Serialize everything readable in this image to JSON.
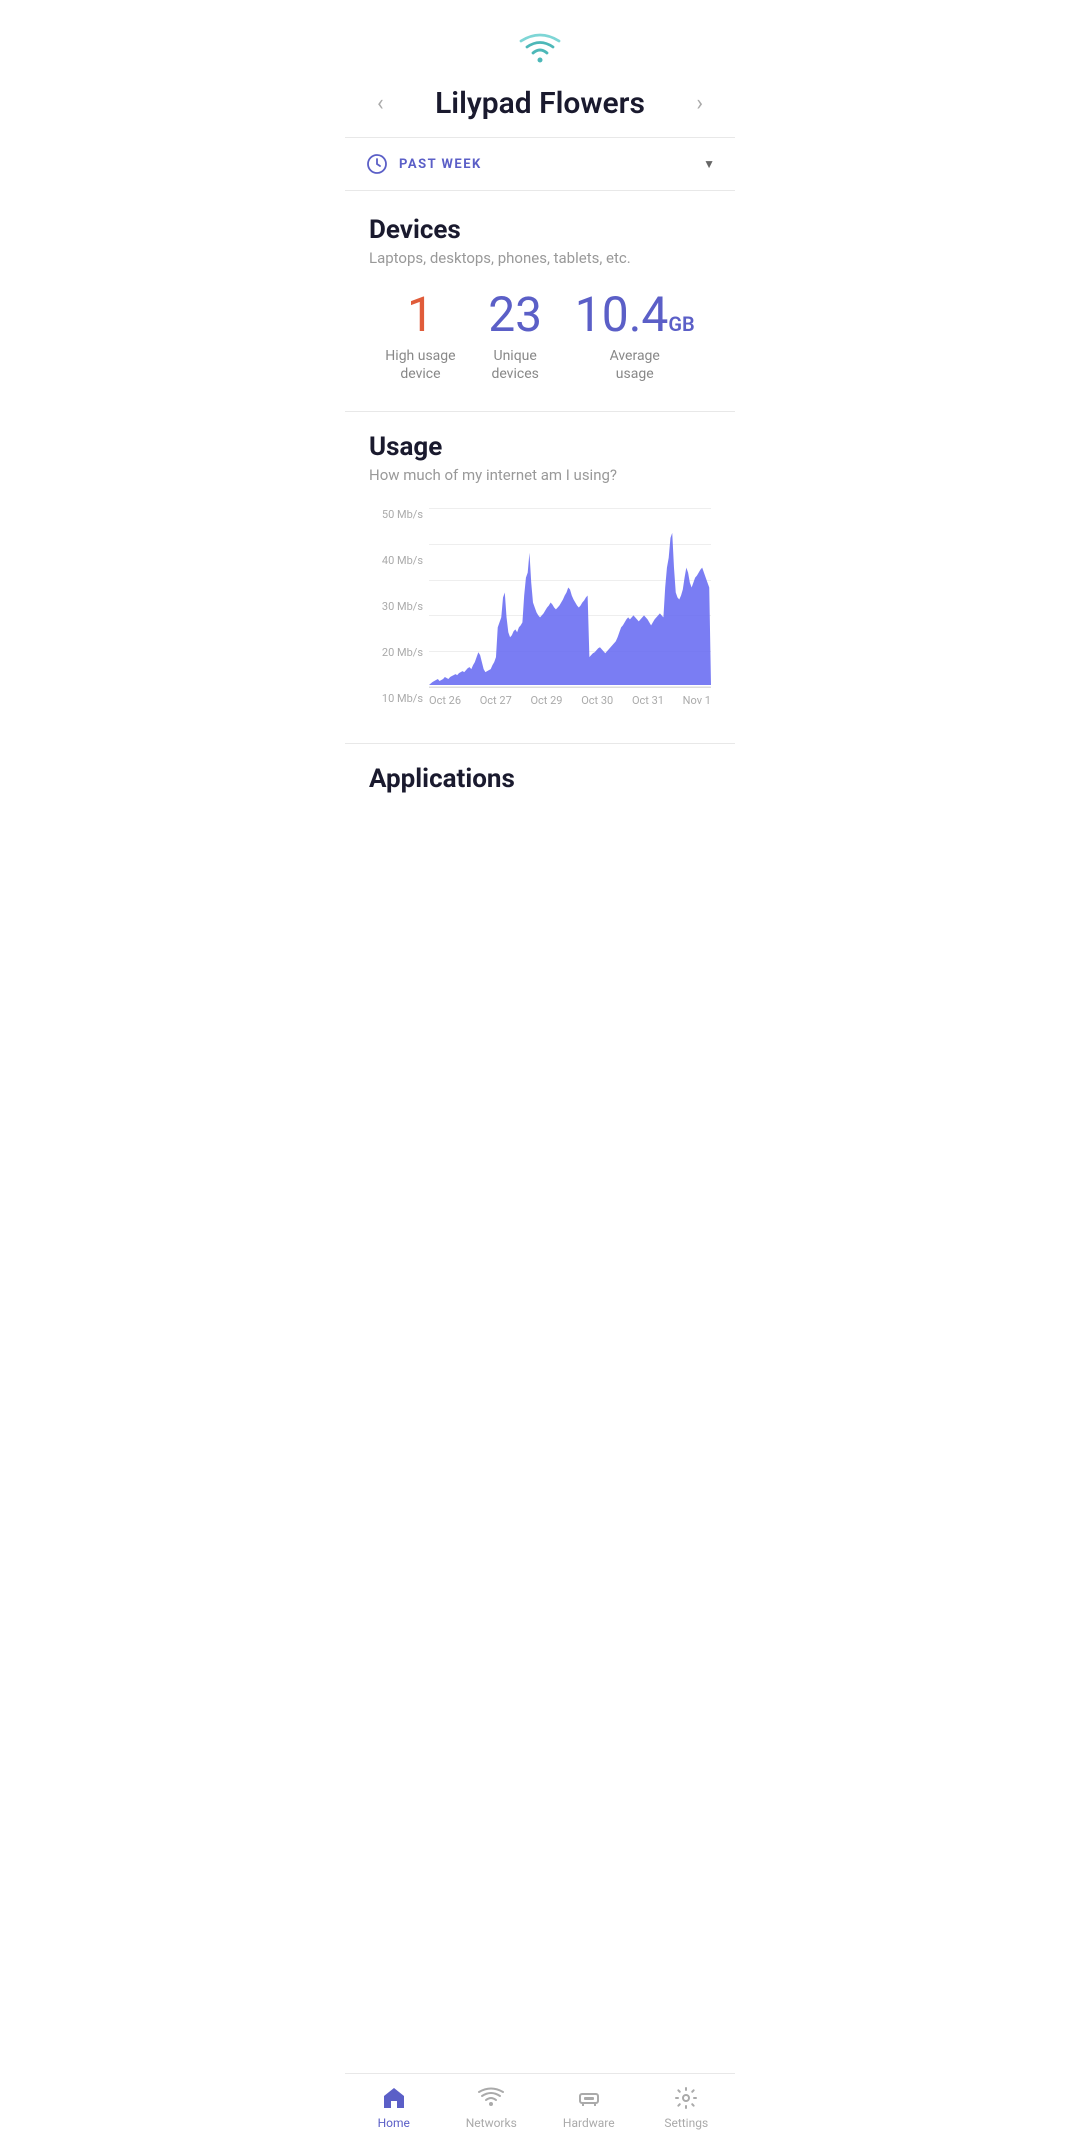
{
  "header": {
    "network_name": "Lilypad Flowers",
    "prev_arrow": "‹",
    "next_arrow": "›"
  },
  "time_filter": {
    "icon": "clock",
    "label": "PAST WEEK",
    "dropdown_arrow": "▼"
  },
  "devices": {
    "title": "Devices",
    "subtitle": "Laptops, desktops, phones, tablets, etc.",
    "stats": [
      {
        "value": "1",
        "label": "High usage\ndevice",
        "color": "red"
      },
      {
        "value": "23",
        "label": "Unique\ndevices",
        "color": "purple"
      },
      {
        "value": "10.4",
        "unit": "GB",
        "label": "Average\nusage",
        "color": "purple"
      }
    ]
  },
  "usage": {
    "title": "Usage",
    "subtitle": "How much of my internet am I using?",
    "y_labels": [
      "50 Mb/s",
      "40 Mb/s",
      "30 Mb/s",
      "20 Mb/s",
      "10 Mb/s"
    ],
    "x_labels": [
      "Oct 26",
      "Oct 27",
      "Oct 29",
      "Oct 30",
      "Oct 31",
      "Nov 1"
    ]
  },
  "applications": {
    "title": "Applications"
  },
  "bottom_nav": [
    {
      "key": "home",
      "label": "Home",
      "active": true
    },
    {
      "key": "networks",
      "label": "Networks",
      "active": false
    },
    {
      "key": "hardware",
      "label": "Hardware",
      "active": false
    },
    {
      "key": "settings",
      "label": "Settings",
      "active": false
    }
  ]
}
